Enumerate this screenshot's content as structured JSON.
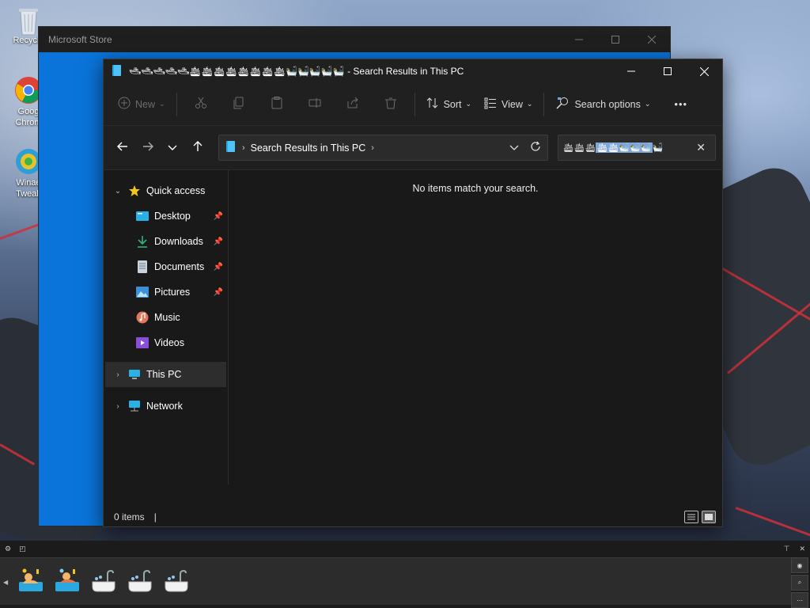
{
  "desktop": {
    "icons": [
      {
        "label": "Recycle",
        "icon": "recycle-bin-icon"
      },
      {
        "label_line1": "Goog",
        "label_line2": "Chrom",
        "icon": "chrome-icon"
      },
      {
        "label_line1": "Winae",
        "label_line2": "Tweak",
        "icon": "winaero-tweaker-icon"
      }
    ]
  },
  "store_window": {
    "title": "Microsoft Store",
    "accent": "#0a74da"
  },
  "explorer": {
    "title_emoji": "🛥🛥🛥🛥🛥🛳🛳🛳🛳🛳🛳🛳🛳🛀🛀🛀🛀🛀",
    "title_text": " - Search Results in This PC",
    "ribbon": {
      "new_label": "New",
      "sort_label": "Sort",
      "view_label": "View",
      "search_options_label": "Search options",
      "more_label": "•••"
    },
    "address": {
      "path": "Search Results in This PC"
    },
    "search": {
      "value_plain": "🛳🛳🛳",
      "value_selected": "🛳🛳🛀🛀🛀",
      "value_tail": "🛀"
    },
    "nav": {
      "quick_access": "Quick access",
      "items": [
        {
          "label": "Desktop",
          "icon": "desktop-folder-icon",
          "pinned": true
        },
        {
          "label": "Downloads",
          "icon": "downloads-folder-icon",
          "pinned": true
        },
        {
          "label": "Documents",
          "icon": "documents-folder-icon",
          "pinned": true
        },
        {
          "label": "Pictures",
          "icon": "pictures-folder-icon",
          "pinned": true
        },
        {
          "label": "Music",
          "icon": "music-folder-icon",
          "pinned": false
        },
        {
          "label": "Videos",
          "icon": "videos-folder-icon",
          "pinned": false
        }
      ],
      "this_pc": "This PC",
      "network": "Network"
    },
    "content": {
      "empty_message": "No items match your search."
    },
    "status": {
      "items_count": "0 items",
      "caret": "|"
    }
  },
  "dock": {
    "emojis": [
      "person-in-bath-icon",
      "person-in-bath-icon",
      "bathtub-icon",
      "bathtub-icon",
      "bathtub-icon"
    ]
  }
}
